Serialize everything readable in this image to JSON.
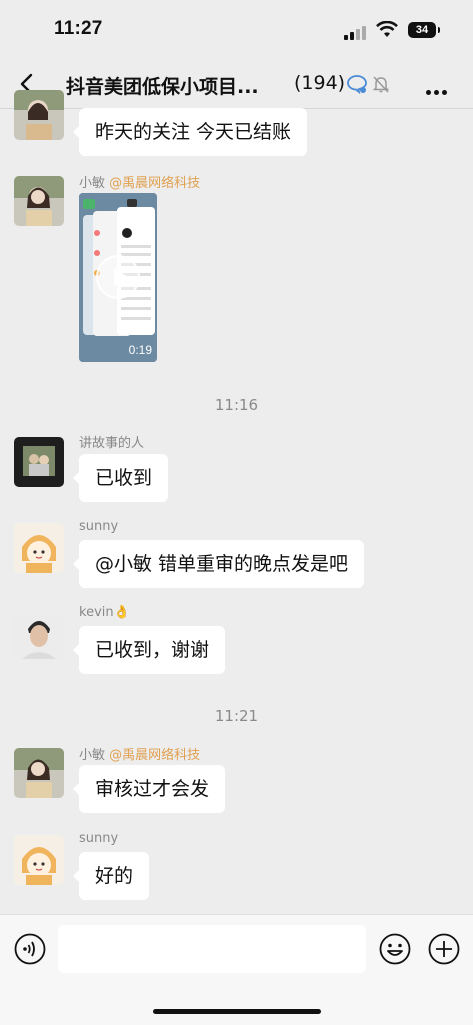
{
  "status_bar": {
    "time": "11:27",
    "battery": "34"
  },
  "header": {
    "title": "抖音美团低保小项目...",
    "member_count": "(194)"
  },
  "messages": [
    {
      "type": "text",
      "text": "昨天的关注 今天已结账"
    },
    {
      "type": "video",
      "sender": "小敏",
      "sender_org": "@禹晨网络科技",
      "duration": "0:19"
    },
    {
      "type": "timestamp",
      "text": "11:16"
    },
    {
      "type": "text",
      "sender": "讲故事的人",
      "text": "已收到"
    },
    {
      "type": "text",
      "sender": "sunny",
      "text": "@小敏 错单重审的晚点发是吧"
    },
    {
      "type": "text",
      "sender": "kevin👌",
      "text": "已收到，谢谢"
    },
    {
      "type": "timestamp",
      "text": "11:21"
    },
    {
      "type": "text",
      "sender": "小敏",
      "sender_org": "@禹晨网络科技",
      "text": "审核过才会发"
    },
    {
      "type": "text",
      "sender": "sunny",
      "text": "好的"
    }
  ],
  "input": {
    "value": "",
    "placeholder": ""
  },
  "icons": {
    "back": "back-arrow-icon",
    "chat": "chat-bubble-icon",
    "mute": "mute-bell-icon",
    "more": "more-icon",
    "voice": "voice-icon",
    "emoji": "emoji-icon",
    "plus": "plus-icon"
  },
  "colors": {
    "background": "#ededed",
    "bubble": "#ffffff",
    "org_tag": "#e0a050",
    "accent": "#1aad19"
  }
}
